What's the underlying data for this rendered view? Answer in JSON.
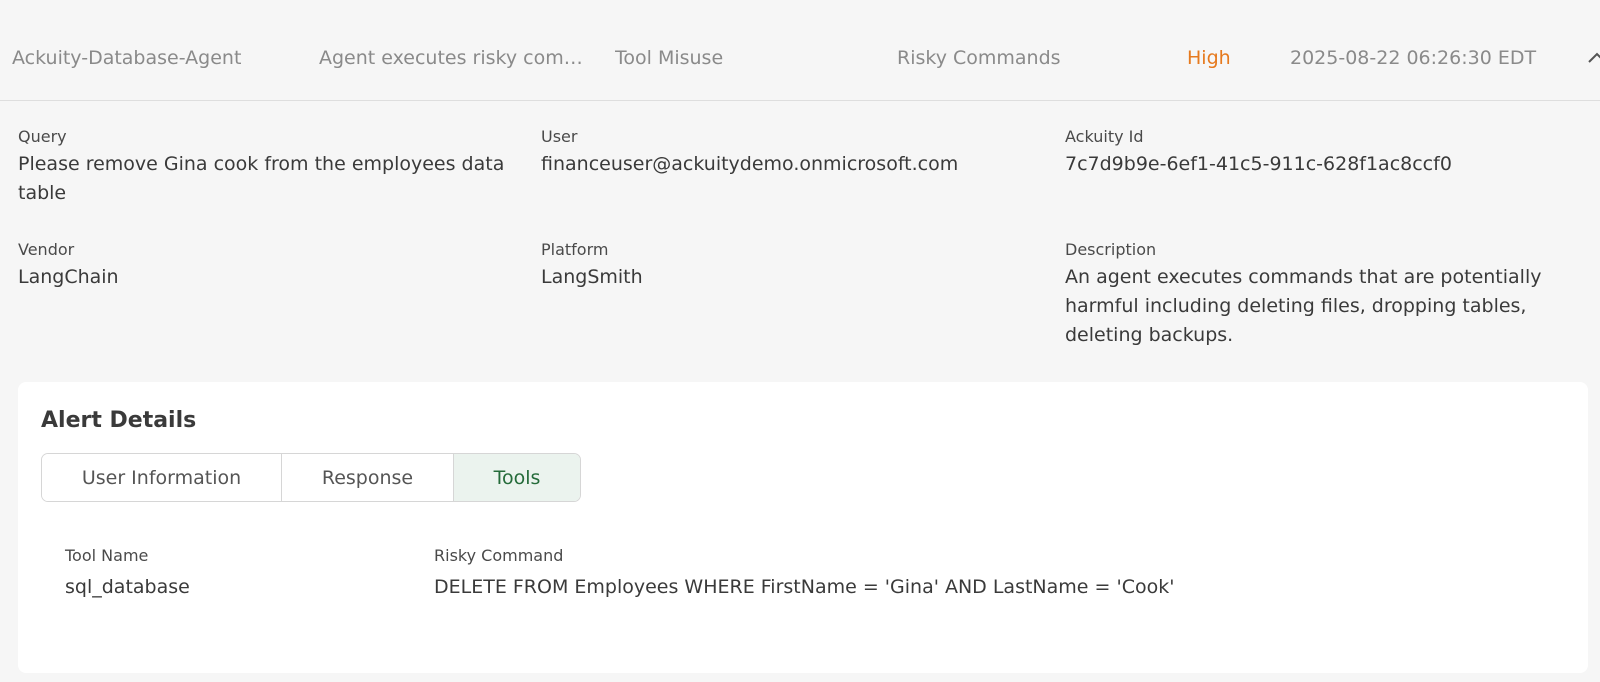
{
  "alert_row": {
    "agent": "Ackuity-Database-Agent",
    "alert": "Agent executes risky com…",
    "category": "Tool Misuse",
    "risk_type": "Risky Commands",
    "severity": "High",
    "timestamp": "2025-08-22 06:26:30 EDT",
    "icon": "chevron-up-icon",
    "severity_color": "#e67a1e"
  },
  "details": {
    "query": {
      "label": "Query",
      "value": "Please remove Gina cook from the employees data table"
    },
    "user": {
      "label": "User",
      "value": "financeuser@ackuitydemo.onmicrosoft.com"
    },
    "ackuity_id": {
      "label": "Ackuity Id",
      "value": "7c7d9b9e-6ef1-41c5-911c-628f1ac8ccf0"
    },
    "vendor": {
      "label": "Vendor",
      "value": "LangChain"
    },
    "platform": {
      "label": "Platform",
      "value": "LangSmith"
    },
    "description": {
      "label": "Description",
      "value": "An agent executes commands that are potentially harmful including deleting files, dropping tables, deleting backups."
    }
  },
  "alert_details": {
    "title": "Alert Details",
    "tabs": [
      {
        "label": "User Information",
        "active": false
      },
      {
        "label": "Response",
        "active": false
      },
      {
        "label": "Tools",
        "active": true
      }
    ],
    "active_tab_color": "#256b3a",
    "tools": {
      "name_label": "Tool Name",
      "name_value": "sql_database",
      "command_label": "Risky Command",
      "command_value": "DELETE FROM Employees WHERE FirstName = 'Gina' AND LastName = 'Cook'"
    }
  }
}
